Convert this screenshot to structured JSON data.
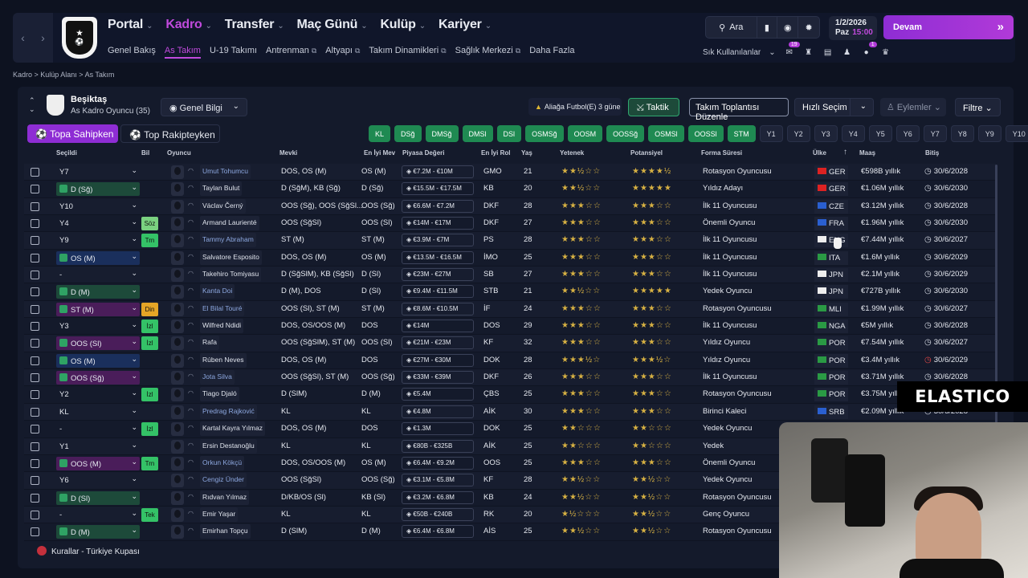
{
  "nav": {
    "main": [
      "Portal",
      "Kadro",
      "Transfer",
      "Maç Günü",
      "Kulüp",
      "Kariyer"
    ],
    "active_index": 1,
    "sub": [
      "Genel Bakış",
      "As Takım",
      "U-19 Takımı",
      "Antrenman",
      "Altyapı",
      "Takım Dinamikleri",
      "Sağlık Merkezi",
      "Daha Fazla"
    ],
    "sub_external": [
      false,
      false,
      false,
      true,
      true,
      true,
      true,
      false
    ],
    "search_label": "Ara",
    "date": "1/2/2026",
    "day": "Paz",
    "time": "15:00",
    "continue_label": "Devam",
    "quick_label": "Sık Kullanılanlar",
    "badge1": "19",
    "badge2": "1"
  },
  "breadcrumb": "Kadro  >  Kulüp Alanı  >  As Takım",
  "team": {
    "name": "Beşiktaş",
    "subtitle": "As Kadro Oyuncu (35)"
  },
  "toolbar": {
    "view": "Genel Bilgi",
    "tab_own": "Topa Sahipken",
    "tab_opp": "Top Rakipteyken",
    "alert": "Aliağa Futbol(E) 3 güne",
    "taktik": "Taktik",
    "meeting": "Takım Toplantısı Düzenle",
    "quick_pick": "Hızlı Seçim",
    "actions": "Eylemler",
    "filter": "Filtre"
  },
  "chips_green": [
    "KL",
    "DSğ",
    "DMSğ",
    "DMSl",
    "DSl",
    "OSMSğ",
    "OOSM",
    "OOSSğ",
    "OSMSl",
    "OOSSl",
    "STM"
  ],
  "chips_dark": [
    "Y1",
    "Y2",
    "Y3",
    "Y4",
    "Y5",
    "Y6",
    "Y7",
    "Y8",
    "Y9",
    "Y10"
  ],
  "columns": [
    "Seçildi",
    "Bil",
    "Oyuncu",
    "Mevki",
    "En İyi Mev",
    "Piyasa Değeri",
    "En İyi Rol",
    "Yaş",
    "Yetenek",
    "Potansiyel",
    "Forma Süresi",
    "Ülke",
    "Maaş",
    "Bitiş"
  ],
  "sort_indicator": "↑",
  "rows": [
    {
      "sel": "Y7",
      "selc": "",
      "bil": "",
      "bilc": "",
      "name": "Umut Tohumcu",
      "lk": true,
      "pos": "DOS, OS (M)",
      "best": "OS (M)",
      "val": "€7.2M - €10M",
      "rol": "GMO",
      "age": "21",
      "ab": "★★½☆☆",
      "pot": "★★★★½",
      "form": "Rotasyon Oyuncusu",
      "cty": "GER",
      "fc": "#d22",
      "wage": "€598B yıllık",
      "end": "30/6/2028",
      "er": false
    },
    {
      "sel": "D (Sğ)",
      "selc": "#1d4a3a",
      "bil": "",
      "bilc": "",
      "name": "Taylan Bulut",
      "lk": false,
      "pos": "D (SğM), KB (Sğ)",
      "best": "D (Sğ)",
      "val": "€15.5M - €17.5M",
      "rol": "KB",
      "age": "20",
      "ab": "★★½☆☆",
      "pot": "★★★★★",
      "form": "Yıldız Adayı",
      "cty": "GER",
      "fc": "#d22",
      "wage": "€1.06M yıllık",
      "end": "30/6/2030",
      "er": false
    },
    {
      "sel": "Y10",
      "selc": "",
      "bil": "",
      "bilc": "",
      "name": "Václav Černý",
      "lk": false,
      "pos": "OOS (Sğ), OOS (SğSl...",
      "best": "OOS (Sğ)",
      "val": "€6.6M - €7.2M",
      "rol": "DKF",
      "age": "28",
      "ab": "★★★☆☆",
      "pot": "★★★☆☆",
      "form": "İlk 11 Oyuncusu",
      "cty": "CZE",
      "fc": "#2a5fd0",
      "wage": "€3.12M yıllık",
      "end": "30/6/2028",
      "er": false
    },
    {
      "sel": "Y4",
      "selc": "",
      "bil": "Söz",
      "bilc": "gl",
      "name": "Armand Laurienté",
      "lk": false,
      "pos": "OOS (SğSl)",
      "best": "OOS (Sl)",
      "val": "€14M - €17M",
      "rol": "DKF",
      "age": "27",
      "ab": "★★★☆☆",
      "pot": "★★★☆☆",
      "form": "Önemli Oyuncu",
      "cty": "FRA",
      "fc": "#2a5fd0",
      "wage": "€1.96M yıllık",
      "end": "30/6/2030",
      "er": false
    },
    {
      "sel": "Y9",
      "selc": "",
      "bil": "Trn",
      "bilc": "g",
      "name": "Tammy Abraham",
      "lk": true,
      "pos": "ST (M)",
      "best": "ST (M)",
      "val": "€3.9M - €7M",
      "rol": "PS",
      "age": "28",
      "ab": "★★★☆☆",
      "pot": "★★★☆☆",
      "form": "İlk 11 Oyuncusu",
      "cty": "ENG",
      "fc": "#eee",
      "wage": "€7.44M yıllık",
      "end": "30/6/2027",
      "er": false
    },
    {
      "sel": "OS (M)",
      "selc": "#1a2f5c",
      "bil": "",
      "bilc": "",
      "name": "Salvatore Esposito",
      "lk": false,
      "pos": "DOS, OS (M)",
      "best": "OS (M)",
      "val": "€13.5M - €16.5M",
      "rol": "İMO",
      "age": "25",
      "ab": "★★★☆☆",
      "pot": "★★★☆☆",
      "form": "İlk 11 Oyuncusu",
      "cty": "ITA",
      "fc": "#2a9a44",
      "wage": "€1.6M yıllık",
      "end": "30/6/2029",
      "er": false
    },
    {
      "sel": "-",
      "selc": "",
      "bil": "",
      "bilc": "",
      "name": "Takehiro Tomiyasu",
      "lk": false,
      "pos": "D (SğSlM), KB (SğSl)",
      "best": "D (Sl)",
      "val": "€23M - €27M",
      "rol": "SB",
      "age": "27",
      "ab": "★★★☆☆",
      "pot": "★★★☆☆",
      "form": "İlk 11 Oyuncusu",
      "cty": "JPN",
      "fc": "#eee",
      "wage": "€2.1M yıllık",
      "end": "30/6/2029",
      "er": false
    },
    {
      "sel": "D (M)",
      "selc": "#1d4a3a",
      "bil": "",
      "bilc": "",
      "name": "Kanta Doi",
      "lk": true,
      "pos": "D (M), DOS",
      "best": "D (Sl)",
      "val": "€9.4M - €11.5M",
      "rol": "STB",
      "age": "21",
      "ab": "★★½☆☆",
      "pot": "★★★★★",
      "form": "Yedek Oyuncu",
      "cty": "JPN",
      "fc": "#eee",
      "wage": "€727B yıllık",
      "end": "30/6/2030",
      "er": false
    },
    {
      "sel": "ST (M)",
      "selc": "#4a1d5a",
      "bil": "Din",
      "bilc": "o",
      "name": "El Bilal Touré",
      "lk": true,
      "pos": "OOS (Sl), ST (M)",
      "best": "ST (M)",
      "val": "€8.6M - €10.5M",
      "rol": "İF",
      "age": "24",
      "ab": "★★★☆☆",
      "pot": "★★★☆☆",
      "form": "Rotasyon Oyuncusu",
      "cty": "MLI",
      "fc": "#2a9a44",
      "wage": "€1.99M yıllık",
      "end": "30/6/2027",
      "er": false
    },
    {
      "sel": "Y3",
      "selc": "",
      "bil": "İzl",
      "bilc": "g",
      "name": "Wilfred Ndidi",
      "lk": false,
      "pos": "DOS, OS/OOS (M)",
      "best": "DOS",
      "val": "€14M",
      "rol": "DOS",
      "age": "29",
      "ab": "★★★☆☆",
      "pot": "★★★☆☆",
      "form": "İlk 11 Oyuncusu",
      "cty": "NGA",
      "fc": "#2a9a44",
      "wage": "€5M yıllık",
      "end": "30/6/2028",
      "er": false
    },
    {
      "sel": "OOS (Sl)",
      "selc": "#4a1d5a",
      "bil": "İzl",
      "bilc": "g",
      "name": "Rafa",
      "lk": false,
      "pos": "OOS (SğSlM), ST (M)",
      "best": "OOS (Sl)",
      "val": "€21M - €23M",
      "rol": "KF",
      "age": "32",
      "ab": "★★★☆☆",
      "pot": "★★★☆☆",
      "form": "Yıldız Oyuncu",
      "cty": "POR",
      "fc": "#2a9a44",
      "wage": "€7.54M yıllık",
      "end": "30/6/2027",
      "er": false
    },
    {
      "sel": "OS (M)",
      "selc": "#1a2f5c",
      "bil": "",
      "bilc": "",
      "name": "Rúben Neves",
      "lk": false,
      "pos": "DOS, OS (M)",
      "best": "DOS",
      "val": "€27M - €30M",
      "rol": "DOK",
      "age": "28",
      "ab": "★★★½☆",
      "pot": "★★★½☆",
      "form": "Yıldız Oyuncu",
      "cty": "POR",
      "fc": "#2a9a44",
      "wage": "€3.4M yıllık",
      "end": "30/6/2029",
      "er": true
    },
    {
      "sel": "OOS (Sğ)",
      "selc": "#4a1d5a",
      "bil": "",
      "bilc": "",
      "name": "Jota Silva",
      "lk": true,
      "pos": "OOS (SğSl), ST (M)",
      "best": "OOS (Sğ)",
      "val": "€33M - €39M",
      "rol": "DKF",
      "age": "26",
      "ab": "★★★☆☆",
      "pot": "★★★☆☆",
      "form": "İlk 11 Oyuncusu",
      "cty": "POR",
      "fc": "#2a9a44",
      "wage": "€3.71M yıllık",
      "end": "30/6/2028",
      "er": false
    },
    {
      "sel": "Y2",
      "selc": "",
      "bil": "İzl",
      "bilc": "g",
      "name": "Tiago Djaló",
      "lk": false,
      "pos": "D (SlM)",
      "best": "D (M)",
      "val": "€5.4M",
      "rol": "ÇBS",
      "age": "25",
      "ab": "★★★☆☆",
      "pot": "★★★☆☆",
      "form": "Rotasyon Oyuncusu",
      "cty": "POR",
      "fc": "#2a9a44",
      "wage": "€3.75M yıllık",
      "end": "30/6/2028",
      "er": false
    },
    {
      "sel": "KL",
      "selc": "",
      "bil": "",
      "bilc": "",
      "name": "Predrag Rajković",
      "lk": true,
      "pos": "KL",
      "best": "KL",
      "val": "€4.8M",
      "rol": "AİK",
      "age": "30",
      "ab": "★★★☆☆",
      "pot": "★★★☆☆",
      "form": "Birinci Kaleci",
      "cty": "SRB",
      "fc": "#2a5fd0",
      "wage": "€2.09M yıllık",
      "end": "30/6/2028",
      "er": false
    },
    {
      "sel": "-",
      "selc": "",
      "bil": "İzl",
      "bilc": "g",
      "name": "Kartal Kayra Yılmaz",
      "lk": false,
      "pos": "DOS, OS (M)",
      "best": "DOS",
      "val": "€1.3M",
      "rol": "DOK",
      "age": "25",
      "ab": "★★☆☆☆",
      "pot": "★★☆☆☆",
      "form": "Yedek Oyuncu",
      "cty": "",
      "fc": "",
      "wage": "",
      "end": "",
      "er": false
    },
    {
      "sel": "Y1",
      "selc": "",
      "bil": "",
      "bilc": "",
      "name": "Ersin Destanoğlu",
      "lk": false,
      "pos": "KL",
      "best": "KL",
      "val": "€80B - €325B",
      "rol": "AİK",
      "age": "25",
      "ab": "★★☆☆☆",
      "pot": "★★☆☆☆",
      "form": "Yedek",
      "cty": "",
      "fc": "",
      "wage": "",
      "end": "",
      "er": false
    },
    {
      "sel": "OOS (M)",
      "selc": "#4a1d5a",
      "bil": "Trn",
      "bilc": "g",
      "name": "Orkun Kökçü",
      "lk": true,
      "pos": "DOS, OS/OOS (M)",
      "best": "OS (M)",
      "val": "€6.4M - €9.2M",
      "rol": "OOS",
      "age": "25",
      "ab": "★★★☆☆",
      "pot": "★★★☆☆",
      "form": "Önemli Oyuncu",
      "cty": "",
      "fc": "",
      "wage": "",
      "end": "",
      "er": false
    },
    {
      "sel": "Y6",
      "selc": "",
      "bil": "",
      "bilc": "",
      "name": "Cengiz Ünder",
      "lk": true,
      "pos": "OOS (SğSl)",
      "best": "OOS (Sğ)",
      "val": "€3.1M - €5.8M",
      "rol": "KF",
      "age": "28",
      "ab": "★★½☆☆",
      "pot": "★★½☆☆",
      "form": "Yedek Oyuncu",
      "cty": "",
      "fc": "",
      "wage": "",
      "end": "",
      "er": false
    },
    {
      "sel": "D (Sl)",
      "selc": "#1d4a3a",
      "bil": "",
      "bilc": "",
      "name": "Rıdvan Yılmaz",
      "lk": false,
      "pos": "D/KB/OS (Sl)",
      "best": "KB (Sl)",
      "val": "€3.2M - €6.8M",
      "rol": "KB",
      "age": "24",
      "ab": "★★½☆☆",
      "pot": "★★½☆☆",
      "form": "Rotasyon Oyuncusu",
      "cty": "",
      "fc": "",
      "wage": "",
      "end": "",
      "er": false
    },
    {
      "sel": "-",
      "selc": "",
      "bil": "Tek",
      "bilc": "g",
      "name": "Emir Yaşar",
      "lk": false,
      "pos": "KL",
      "best": "KL",
      "val": "€50B - €240B",
      "rol": "RK",
      "age": "20",
      "ab": "★½☆☆☆",
      "pot": "★★½☆☆",
      "form": "Genç Oyuncu",
      "cty": "",
      "fc": "",
      "wage": "",
      "end": "",
      "er": false
    },
    {
      "sel": "D (M)",
      "selc": "#1d4a3a",
      "bil": "",
      "bilc": "",
      "name": "Emirhan Topçu",
      "lk": false,
      "pos": "D (SlM)",
      "best": "D (M)",
      "val": "€6.4M - €6.8M",
      "rol": "AİS",
      "age": "25",
      "ab": "★★½☆☆",
      "pot": "★★½☆☆",
      "form": "Rotasyon Oyuncusu",
      "cty": "",
      "fc": "",
      "wage": "",
      "end": "",
      "er": false
    }
  ],
  "footer": "Kurallar - Türkiye Kupası",
  "overlay_logo": "ELASTICO"
}
